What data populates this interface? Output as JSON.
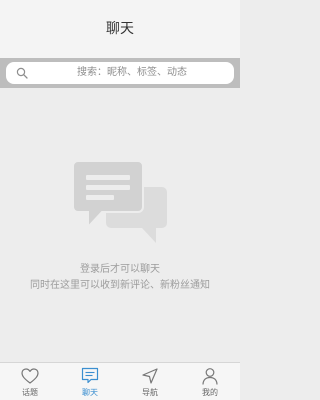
{
  "header": {
    "title": "聊天"
  },
  "search": {
    "placeholder": "搜索：昵称、标签、动态"
  },
  "empty_state": {
    "icon": "chat-bubbles-icon",
    "line1": "登录后才可以聊天",
    "line2": "同时在这里可以收到新评论、新粉丝通知"
  },
  "nav": {
    "items": [
      {
        "label": "话题",
        "icon": "heart-icon",
        "active": false
      },
      {
        "label": "聊天",
        "icon": "chat-icon",
        "active": true
      },
      {
        "label": "导航",
        "icon": "navigation-arrow-icon",
        "active": false
      },
      {
        "label": "我的",
        "icon": "user-icon",
        "active": false
      }
    ]
  },
  "colors": {
    "active": "#3b8fd0",
    "inactive": "#666666",
    "background": "#ededed",
    "search_band": "#bdbdbd"
  }
}
